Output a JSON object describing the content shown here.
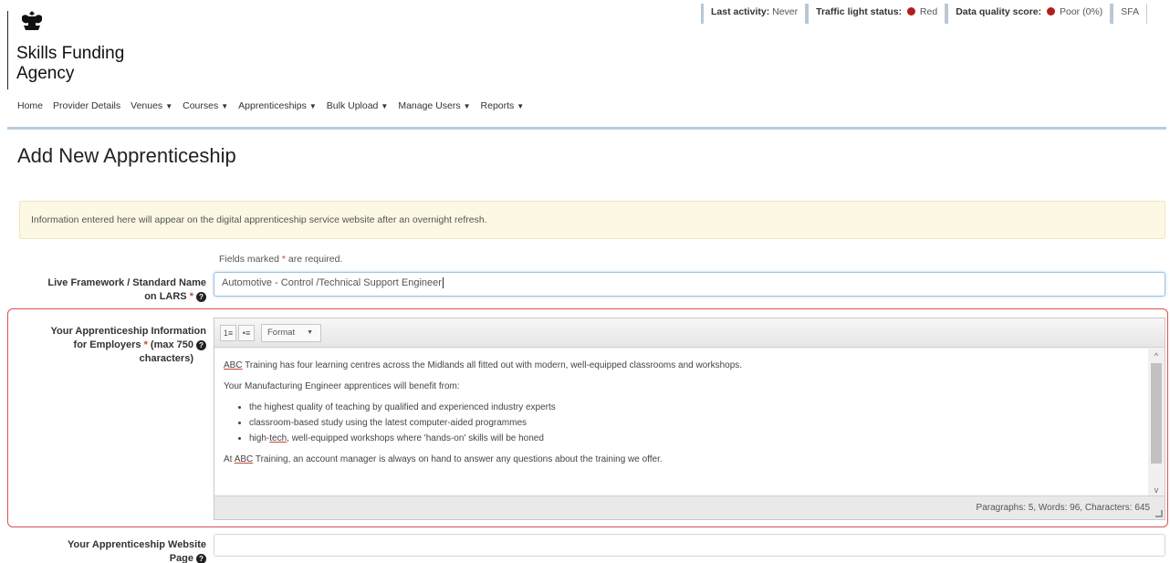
{
  "logo": {
    "org_name_line1": "Skills Funding",
    "org_name_line2": "Agency"
  },
  "status_bar": {
    "last_activity_label": "Last activity:",
    "last_activity_value": "Never",
    "traffic_light_label": "Traffic light status:",
    "traffic_light_value": "Red",
    "data_quality_label": "Data quality score:",
    "data_quality_value": "Poor (0%)",
    "org_abbr": "SFA",
    "status_color": "#b01e1e"
  },
  "nav": {
    "items": [
      {
        "label": "Home"
      },
      {
        "label": "Provider Details"
      },
      {
        "label": "Venues"
      },
      {
        "label": "Courses"
      },
      {
        "label": "Apprenticeships"
      },
      {
        "label": "Bulk Upload"
      },
      {
        "label": "Manage Users"
      },
      {
        "label": "Reports"
      }
    ]
  },
  "page": {
    "title": "Add New Apprenticeship",
    "alert": "Information entered here will appear on the digital apprenticeship service website after an overnight refresh.",
    "required_note_prefix": "Fields marked ",
    "required_note_suffix": " are required."
  },
  "fields": {
    "framework": {
      "label_line1": "Live Framework / Standard Name",
      "label_line2": "on LARS",
      "value": "Automotive - Control /Technical Support Engineer"
    },
    "info": {
      "label_line1": "Your Apprenticeship Information",
      "label_line2": "for Employers",
      "label_line2_suffix": "(max 750",
      "label_line3": "characters)"
    },
    "website": {
      "label_line1": "Your Apprenticeship Website",
      "label_line2": "Page",
      "value": ""
    }
  },
  "editor": {
    "format_label": "Format",
    "para1_abbr": "ABC",
    "para1_rest": " Training has four learning centres across the Midlands all fitted out with modern, well-equipped classrooms and workshops.",
    "para2": "Your Manufacturing Engineer apprentices will benefit from:",
    "bullet1": "the highest quality of teaching by qualified and experienced industry experts",
    "bullet2": "classroom-based study using the latest computer-aided programmes",
    "bullet3_pre": "high-",
    "bullet3_sp": "tech",
    "bullet3_rest": ", well-equipped workshops where 'hands-on' skills will be honed",
    "para4_pre": "At ",
    "para4_abbr": "ABC",
    "para4_rest": " Training, an account manager is always on hand to answer any questions about the training we offer.",
    "stats": "Paragraphs: 5, Words: 96, Characters: 645"
  },
  "icons": {
    "crest": "royal-crest-icon",
    "help": "question-circle-icon",
    "caret": "caret-down-icon"
  }
}
